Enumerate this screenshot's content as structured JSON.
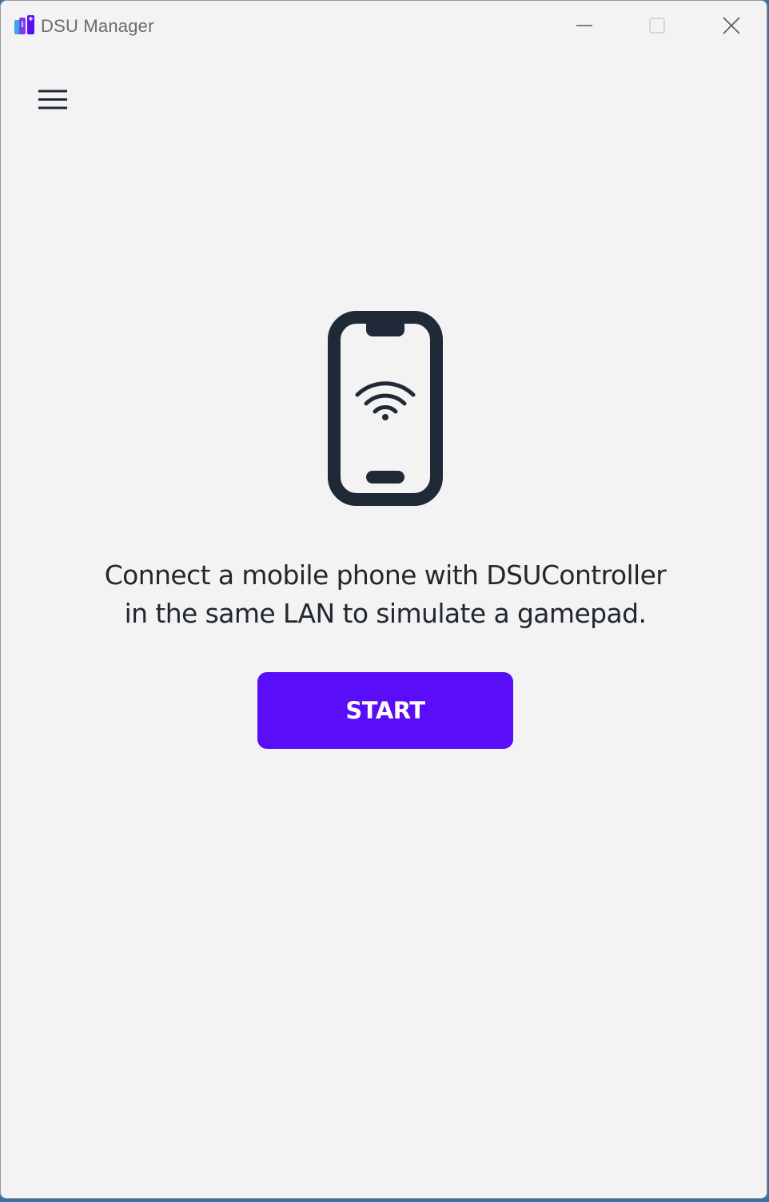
{
  "window": {
    "title": "DSU Manager",
    "icons": {
      "app": "dsu-app-icon",
      "minimize": "minimize-icon",
      "maximize": "maximize-icon",
      "close": "close-icon"
    }
  },
  "toolbar": {
    "menu_icon": "hamburger-menu-icon"
  },
  "main": {
    "illustration_icon": "phone-wifi-icon",
    "message_line1": "Connect a mobile phone with DSUController",
    "message_line2": "in the same LAN to simulate a gamepad.",
    "start_label": "START"
  },
  "colors": {
    "background": "#f3f3f3",
    "accent": "#5a0ef8",
    "text": "#22282f",
    "icon": "#1f2937"
  }
}
